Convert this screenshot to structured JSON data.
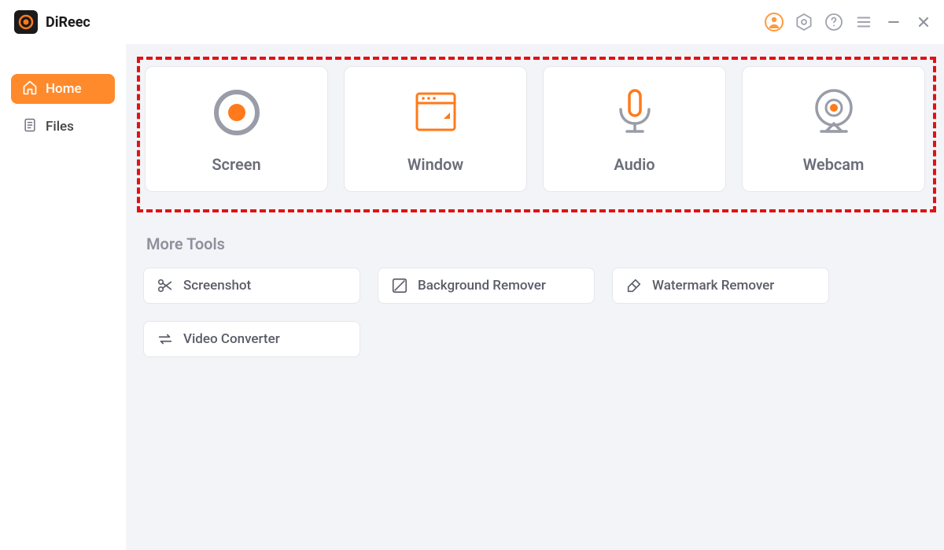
{
  "app": {
    "name": "DiReec"
  },
  "sidebar": {
    "items": [
      {
        "label": "Home",
        "active": true
      },
      {
        "label": "Files",
        "active": false
      }
    ]
  },
  "modes": [
    {
      "label": "Screen"
    },
    {
      "label": "Window"
    },
    {
      "label": "Audio"
    },
    {
      "label": "Webcam"
    }
  ],
  "sections": {
    "more_tools_title": "More Tools"
  },
  "tools": [
    {
      "label": "Screenshot"
    },
    {
      "label": "Background Remover"
    },
    {
      "label": "Watermark Remover"
    },
    {
      "label": "Video Converter"
    }
  ]
}
